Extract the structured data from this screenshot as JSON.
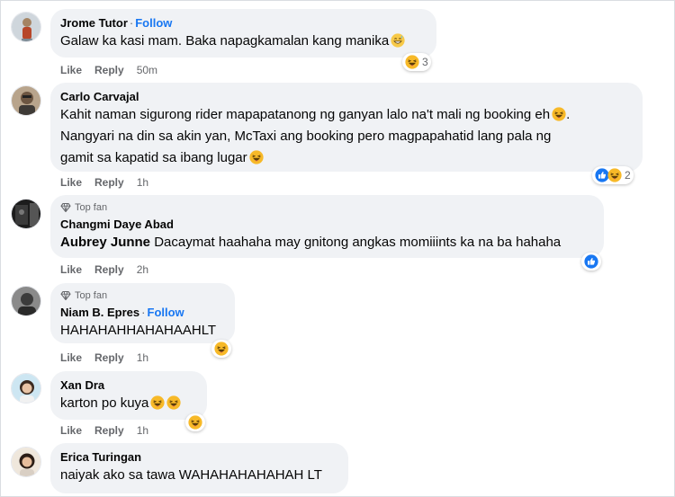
{
  "comments": [
    {
      "name": "Jrome Tutor",
      "follow": "Follow",
      "text": "Galaw ka kasi mam. Baka napagkamalan kang manika",
      "reaction_count": "3",
      "like": "Like",
      "reply": "Reply",
      "time": "50m"
    },
    {
      "name": "Carlo Carvajal",
      "lines": [
        "Kahit naman sigurong rider mapapatanong ng ganyan lalo na't mali ng booking eh",
        "Nangyari na din sa akin yan, McTaxi ang booking pero magpapahatid lang pala ng",
        "gamit sa kapatid sa ibang lugar"
      ],
      "reaction_count": "2",
      "like": "Like",
      "reply": "Reply",
      "time": "1h"
    },
    {
      "badge": "Top fan",
      "name": "Changmi Daye Abad",
      "mention": "Aubrey Junne",
      "text": "Dacaymat haahaha may gnitong angkas momiiints ka na ba hahaha",
      "like": "Like",
      "reply": "Reply",
      "time": "2h"
    },
    {
      "badge": "Top fan",
      "name": "Niam B. Epres",
      "follow": "Follow",
      "text": "HAHAHAHHAHAHAAHLT",
      "like": "Like",
      "reply": "Reply",
      "time": "1h"
    },
    {
      "name": "Xan Dra",
      "text": "karton po kuya",
      "like": "Like",
      "reply": "Reply",
      "time": "1h"
    },
    {
      "name": "Erica Turingan",
      "text": "naiyak ako sa tawa WAHAHAHAHAHAH LT"
    }
  ],
  "colors": {
    "bubble": "#f0f2f5",
    "follow": "#1877f2",
    "meta": "#65676b",
    "haha": "#f7b928",
    "like": "#1877f2"
  },
  "icons": [
    "haha-emoji-icon",
    "grinning-sweat-emoji-icon",
    "like-reaction-icon",
    "top-fan-diamond-icon",
    "avatar-image"
  ]
}
